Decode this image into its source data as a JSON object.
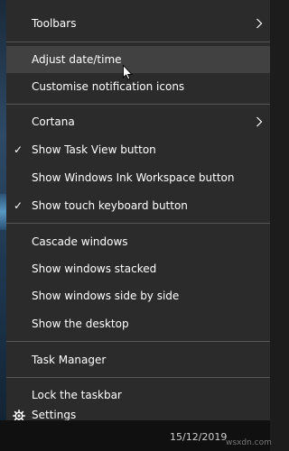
{
  "menu": {
    "items": [
      {
        "label": "Toolbars",
        "submenu": true
      },
      {
        "label": "Adjust date/time",
        "hovered": true
      },
      {
        "label": "Customise notification icons"
      },
      {
        "label": "Cortana",
        "submenu": true
      },
      {
        "label": "Show Task View button",
        "checked": true
      },
      {
        "label": "Show Windows Ink Workspace button"
      },
      {
        "label": "Show touch keyboard button",
        "checked": true
      },
      {
        "label": "Cascade windows"
      },
      {
        "label": "Show windows stacked"
      },
      {
        "label": "Show windows side by side"
      },
      {
        "label": "Show the desktop"
      },
      {
        "label": "Task Manager"
      },
      {
        "label": "Lock the taskbar"
      },
      {
        "label": "Settings",
        "icon": "gear-icon"
      }
    ],
    "check_glyph": "✓",
    "hover_color": "#414141",
    "background_color": "#2b2b2b"
  },
  "taskbar": {
    "date": "15/12/2019",
    "watermark": "wsxdn.com"
  }
}
